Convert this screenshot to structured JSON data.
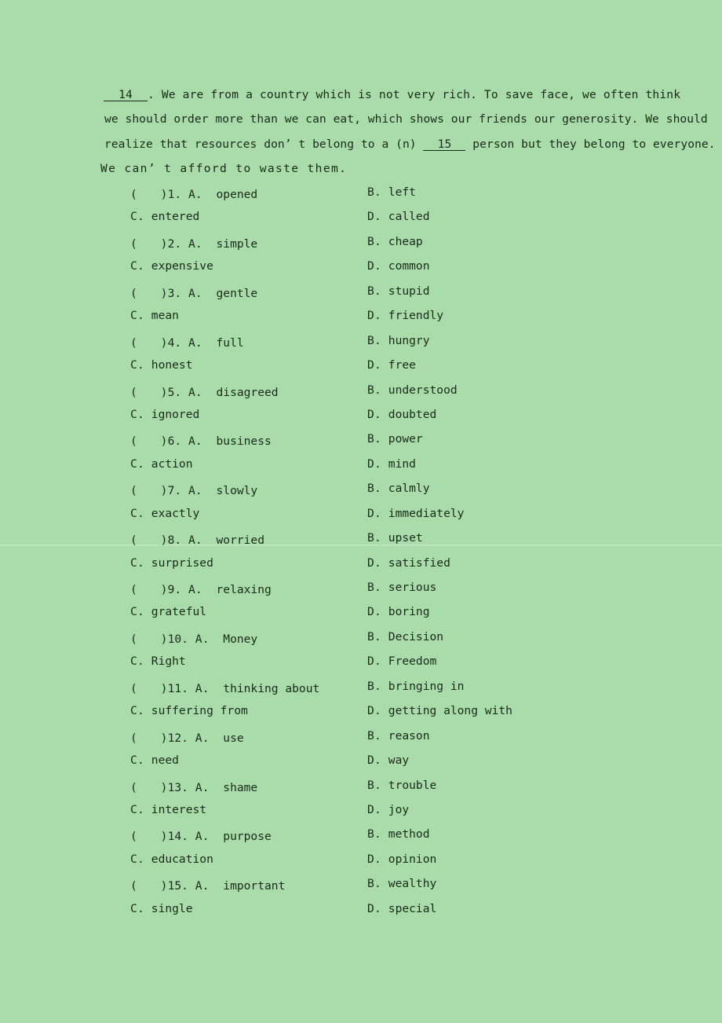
{
  "document": {
    "background_color": "#a9dcaa",
    "text_color": "#1a2a1a"
  },
  "passage": {
    "lines": [
      {
        "id": "line1",
        "blank_number": "14",
        "text_after": ". We are from a country which is not very rich. To save face, we often think"
      },
      {
        "id": "line2",
        "text": "we should order more than we can eat, which shows our friends our generosity. We should"
      },
      {
        "id": "line3",
        "text_before": "realize that resources don’ t belong to a (n) ",
        "blank_number": "15",
        "text_after": " person but they belong to everyone."
      },
      {
        "id": "line4",
        "text": "We can’ t afford to waste them."
      }
    ]
  },
  "questions": [
    {
      "number": "1",
      "checkbox": "(　　)",
      "a_label": "A.",
      "a_text": "opened",
      "b_label": "B.",
      "b_text": "left",
      "c_label": "C.",
      "c_text": "entered",
      "d_label": "D.",
      "d_text": "called"
    },
    {
      "number": "2",
      "checkbox": "(　　)",
      "a_label": "A.",
      "a_text": "simple",
      "b_label": "B.",
      "b_text": "cheap",
      "c_label": "C.",
      "c_text": "expensive",
      "d_label": "D.",
      "d_text": "common"
    },
    {
      "number": "3",
      "checkbox": "(　　)",
      "a_label": "A.",
      "a_text": "gentle",
      "b_label": "B.",
      "b_text": "stupid",
      "c_label": "C.",
      "c_text": "mean",
      "d_label": "D.",
      "d_text": "friendly"
    },
    {
      "number": "4",
      "checkbox": "(　　)",
      "a_label": "A.",
      "a_text": "full",
      "b_label": "B.",
      "b_text": "hungry",
      "c_label": "C.",
      "c_text": "honest",
      "d_label": "D.",
      "d_text": "free"
    },
    {
      "number": "5",
      "checkbox": "(　　)",
      "a_label": "A.",
      "a_text": "disagreed",
      "b_label": "B.",
      "b_text": "understood",
      "c_label": "C.",
      "c_text": "ignored",
      "d_label": "D.",
      "d_text": "doubted"
    },
    {
      "number": "6",
      "checkbox": "(　　)",
      "a_label": "A.",
      "a_text": "business",
      "b_label": "B.",
      "b_text": "power",
      "c_label": "C.",
      "c_text": "action",
      "d_label": "D.",
      "d_text": "mind"
    },
    {
      "number": "7",
      "checkbox": "(　　)",
      "a_label": "A.",
      "a_text": "slowly",
      "b_label": "B.",
      "b_text": "calmly",
      "c_label": "C.",
      "c_text": "exactly",
      "d_label": "D.",
      "d_text": "immediately"
    },
    {
      "number": "8",
      "checkbox": "(　　)",
      "a_label": "A.",
      "a_text": "worried",
      "b_label": "B.",
      "b_text": "upset",
      "c_label": "C.",
      "c_text": "surprised",
      "d_label": "D.",
      "d_text": "satisfied"
    },
    {
      "number": "9",
      "checkbox": "(　　)",
      "a_label": "A.",
      "a_text": "relaxing",
      "b_label": "B.",
      "b_text": "serious",
      "c_label": "C.",
      "c_text": "grateful",
      "d_label": "D.",
      "d_text": "boring"
    },
    {
      "number": "10",
      "checkbox": "(　　)",
      "a_label": "A.",
      "a_text": "Money",
      "b_label": "B.",
      "b_text": "Decision",
      "c_label": "C.",
      "c_text": "Right",
      "d_label": "D.",
      "d_text": "Freedom"
    },
    {
      "number": "11",
      "checkbox": "(　　)",
      "a_label": "A.",
      "a_text": "thinking about",
      "b_label": "B.",
      "b_text": "bringing in",
      "c_label": "C.",
      "c_text": "suffering from",
      "d_label": "D.",
      "d_text": "getting along with"
    },
    {
      "number": "12",
      "checkbox": "(　　)",
      "a_label": "A.",
      "a_text": "use",
      "b_label": "B.",
      "b_text": "reason",
      "c_label": "C.",
      "c_text": "need",
      "d_label": "D.",
      "d_text": "way"
    },
    {
      "number": "13",
      "checkbox": "(　　)",
      "a_label": "A.",
      "a_text": "shame",
      "b_label": "B.",
      "b_text": "trouble",
      "c_label": "C.",
      "c_text": "interest",
      "d_label": "D.",
      "d_text": "joy"
    },
    {
      "number": "14",
      "checkbox": "(　　)",
      "a_label": "A.",
      "a_text": "purpose",
      "b_label": "B.",
      "b_text": "method",
      "c_label": "C.",
      "c_text": "education",
      "d_label": "D.",
      "d_text": "opinion"
    },
    {
      "number": "15",
      "checkbox": "(　　)",
      "a_label": "A.",
      "a_text": "important",
      "b_label": "B.",
      "b_text": "wealthy",
      "c_label": "C.",
      "c_text": "single",
      "d_label": "D.",
      "d_text": "special"
    }
  ]
}
